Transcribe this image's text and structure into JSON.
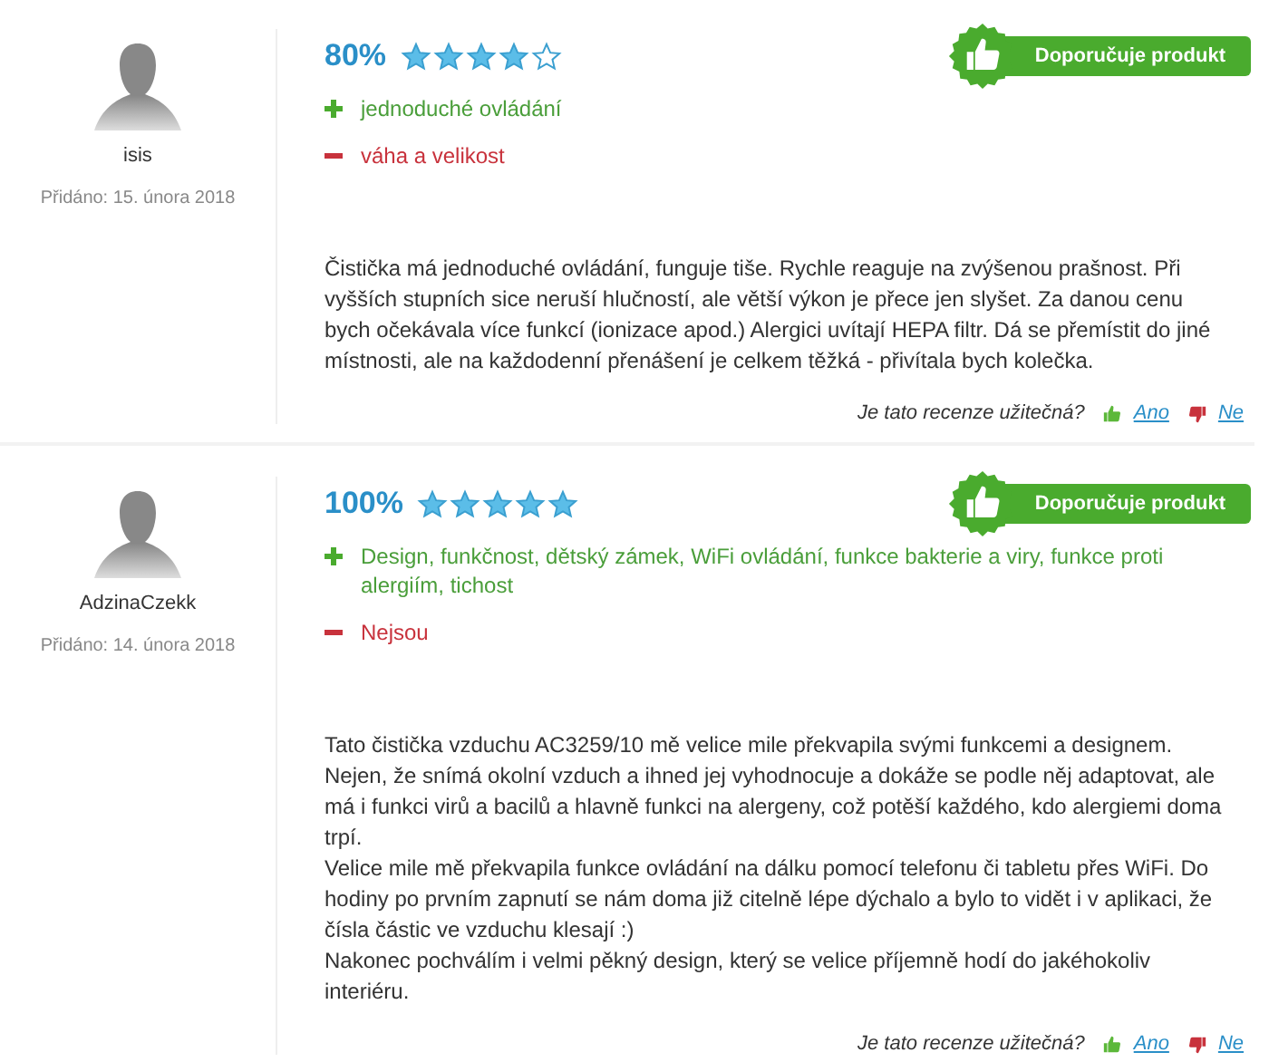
{
  "reviews": [
    {
      "author": "isis",
      "date": "Přidáno: 15. února 2018",
      "score": "80%",
      "stars": 4,
      "recommends": true,
      "badge": "Doporučuje produkt",
      "pros": "jednoduché ovládání",
      "cons": "váha a velikost",
      "body": [
        "Čistička má jednoduché ovládání, funguje tiše. Rychle reaguje na zvýšenou prašnost. Při vyšších stupních sice neruší hlučností, ale větší výkon je přece jen slyšet. Za danou cenu bych očekávala více funkcí (ionizace apod.) Alergici uvítají HEPA filtr. Dá se přemístit do jiné místnosti, ale na každodenní přenášení je celkem těžká - přivítala bych kolečka."
      ],
      "helpful": "Je tato recenze užitečná?",
      "yes": "Ano",
      "no": "Ne"
    },
    {
      "author": "AdzinaCzekk",
      "date": "Přidáno: 14. února 2018",
      "score": "100%",
      "stars": 5,
      "recommends": true,
      "badge": "Doporučuje produkt",
      "pros": "Design, funkčnost, dětský zámek, WiFi ovládání, funkce bakterie a viry, funkce proti alergiím, tichost",
      "cons": "Nejsou",
      "body": [
        "Tato čistička vzduchu AC3259/10 mě velice mile překvapila svými funkcemi a designem.",
        "Nejen, že snímá okolní vzduch a ihned jej vyhodnocuje a dokáže se podle něj adaptovat, ale má i funkci virů a bacilů a hlavně funkci na alergeny, což potěší každého, kdo alergiemi doma trpí.",
        "Velice mile mě překvapila funkce ovládání na dálku pomocí telefonu či tabletu přes WiFi. Do hodiny po prvním zapnutí se nám doma již citelně lépe dýchalo a bylo to vidět i v aplikaci, že čísla částic ve vzduchu klesají :)",
        "Nakonec pochválím i velmi pěkný design, který se velice příjemně hodí do jakéhokoliv interiéru."
      ],
      "helpful": "Je tato recenze užitečná?",
      "yes": "Ano",
      "no": "Ne"
    }
  ]
}
